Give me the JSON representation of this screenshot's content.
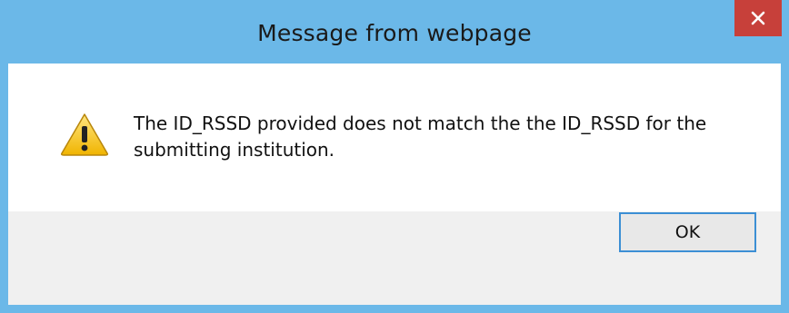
{
  "dialog": {
    "title": "Message from webpage",
    "close_icon": "close-icon",
    "icon": "warning-icon",
    "message": "The ID_RSSD provided does not match the the ID_RSSD for the submitting institution.",
    "ok_label": "OK"
  },
  "colors": {
    "frame": "#6bb8e8",
    "close_button": "#c7403a",
    "content_bg": "#ffffff",
    "footer_bg": "#f0f0f0",
    "ok_border": "#3c8fd4"
  }
}
